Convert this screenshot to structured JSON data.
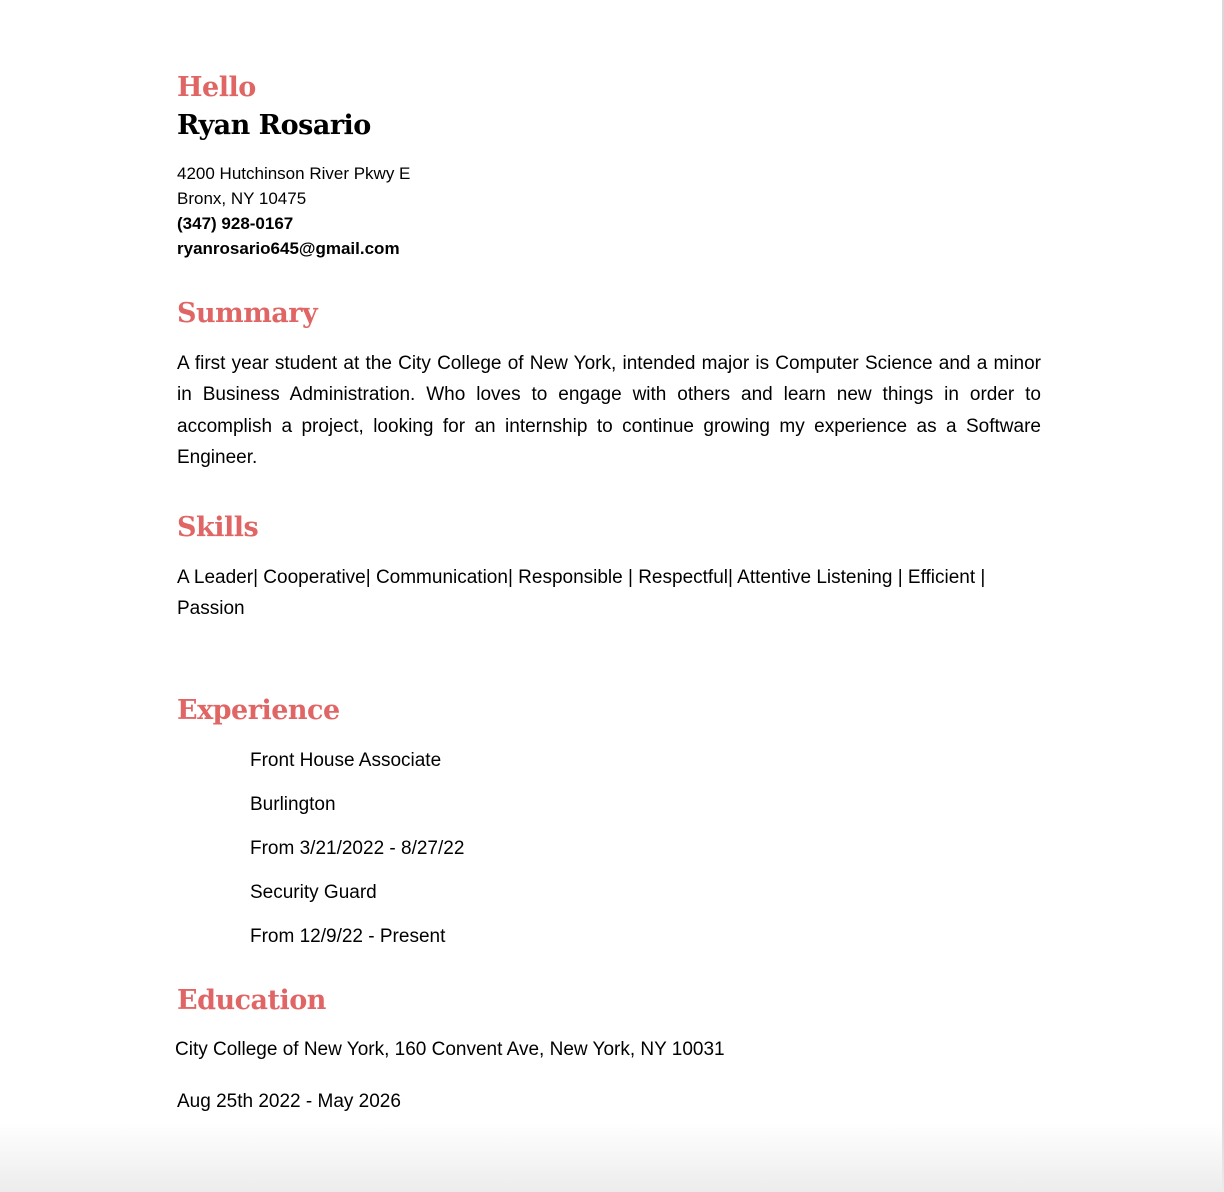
{
  "header": {
    "greeting": "Hello",
    "name": "Ryan Rosario"
  },
  "contact": {
    "address_line1": "4200 Hutchinson River Pkwy E",
    "address_line2": "Bronx, NY 10475",
    "phone": "(347) 928-0167",
    "email": "ryanrosario645@gmail.com"
  },
  "summary": {
    "heading": "Summary",
    "text": " A first year student at the City College of New York, intended major is Computer Science and a minor in Business Administration. Who loves to engage with others and learn new things in order to accomplish a project, looking for an internship to continue growing my experience as a Software Engineer."
  },
  "skills": {
    "heading": "Skills",
    "text": "A Leader| Cooperative| Communication| Responsible | Respectful| Attentive Listening | Efficient | Passion"
  },
  "experience": {
    "heading": "Experience",
    "items": [
      "Front House Associate",
      "Burlington",
      "From 3/21/2022 - 8/27/22",
      "Security Guard",
      "From 12/9/22 - Present"
    ]
  },
  "education": {
    "heading": "Education",
    "school": "City College of New York, 160 Convent Ave, New York, NY 10031",
    "dates": "Aug 25th 2022 - May 2026"
  },
  "colors": {
    "accent": "#e06666",
    "text": "#000000",
    "background": "#ffffff"
  }
}
